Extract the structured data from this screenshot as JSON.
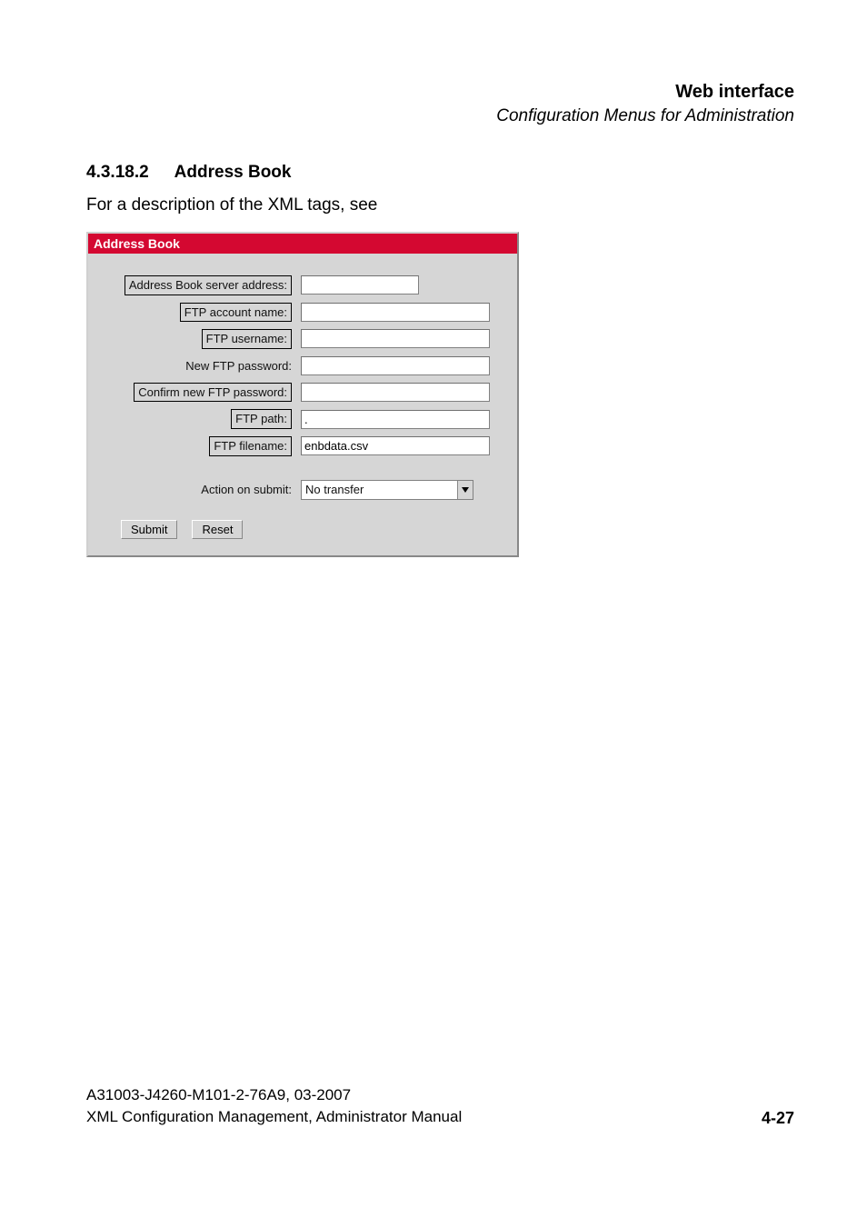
{
  "header": {
    "title": "Web interface",
    "subtitle": "Configuration Menus for Administration"
  },
  "section": {
    "number": "4.3.18.2",
    "title": "Address Book",
    "desc": "For a description of the XML tags, see"
  },
  "panel": {
    "title": "Address Book",
    "fields": {
      "server_address": {
        "label": "Address Book server address:",
        "value": ""
      },
      "account_name": {
        "label": "FTP account name:",
        "value": ""
      },
      "username": {
        "label": "FTP username:",
        "value": ""
      },
      "new_password": {
        "label": "New FTP password:",
        "value": ""
      },
      "confirm_password": {
        "label": "Confirm new FTP password:",
        "value": ""
      },
      "path": {
        "label": "FTP path:",
        "value": "."
      },
      "filename": {
        "label": "FTP filename:",
        "value": "enbdata.csv"
      },
      "action": {
        "label": "Action on submit:",
        "value": "No transfer"
      }
    },
    "buttons": {
      "submit": "Submit",
      "reset": "Reset"
    }
  },
  "footer": {
    "line1": "A31003-J4260-M101-2-76A9, 03-2007",
    "line2": "XML Configuration Management, Administrator Manual",
    "page": "4-27"
  }
}
